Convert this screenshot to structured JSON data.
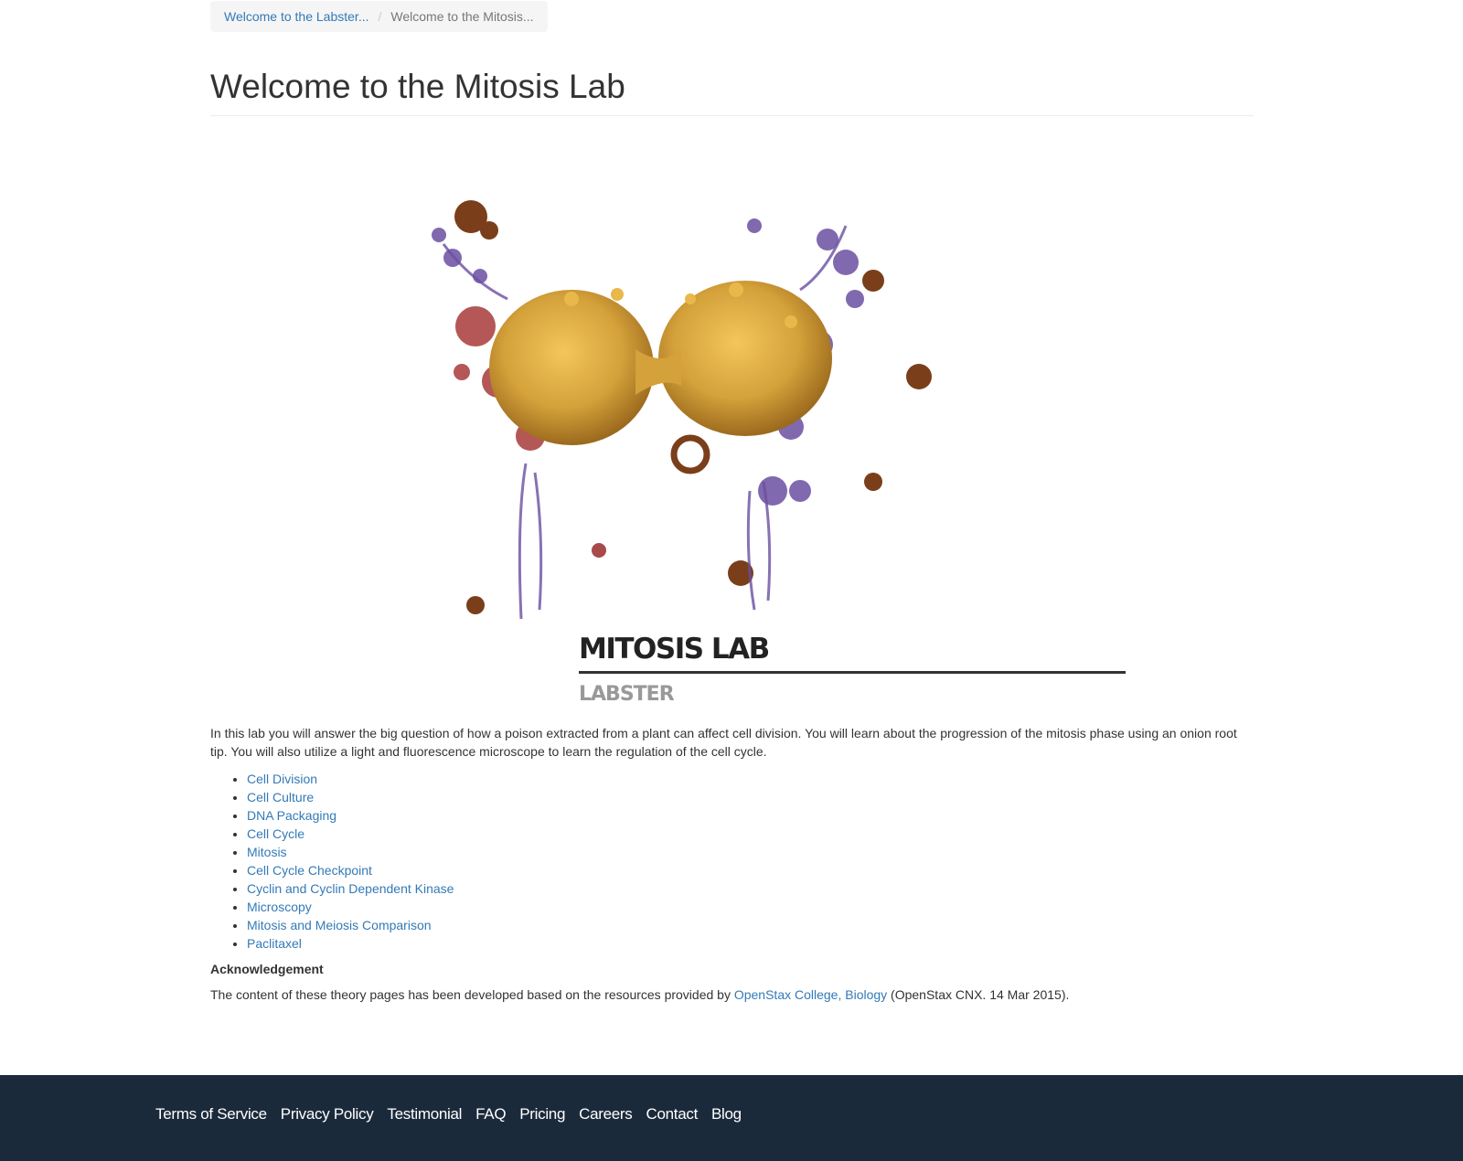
{
  "breadcrumb": {
    "items": [
      {
        "label": "Welcome to the Labster..."
      },
      {
        "label": "Welcome to the Mitosis..."
      }
    ],
    "separator": "/"
  },
  "page": {
    "title": "Welcome to the Mitosis Lab"
  },
  "hero": {
    "lab_title": "MITOSIS LAB",
    "lab_subtitle": "LABSTER"
  },
  "intro": "In this lab you will answer the big question of how a poison extracted from a plant can affect cell division. You will learn about the progression of the mitosis phase using an onion root tip. You will also utilize a light and fluorescence microscope to learn the regulation of the cell cycle.",
  "topics": [
    "Cell Division",
    "Cell Culture",
    "DNA Packaging",
    "Cell Cycle",
    "Mitosis",
    "Cell Cycle Checkpoint",
    "Cyclin and Cyclin Dependent Kinase",
    "Microscopy",
    "Mitosis and Meiosis Comparison",
    "Paclitaxel"
  ],
  "acknowledgement": {
    "heading": "Acknowledgement",
    "text_before": "The content of these theory pages has been developed based on the resources provided by ",
    "link": "OpenStax College, Biology",
    "text_after": " (OpenStax CNX. 14 Mar 2015)."
  },
  "footer": {
    "links": [
      "Terms of Service",
      "Privacy Policy",
      "Testimonial",
      "FAQ",
      "Pricing",
      "Careers",
      "Contact",
      "Blog"
    ]
  },
  "colors": {
    "link": "#337ab7",
    "footer_bg": "#1b2a3b",
    "cell_gold": "#d4a13a",
    "cell_purple": "#6a4fa0",
    "cell_red": "#a83a3a",
    "cell_brown": "#7a3f1a"
  }
}
